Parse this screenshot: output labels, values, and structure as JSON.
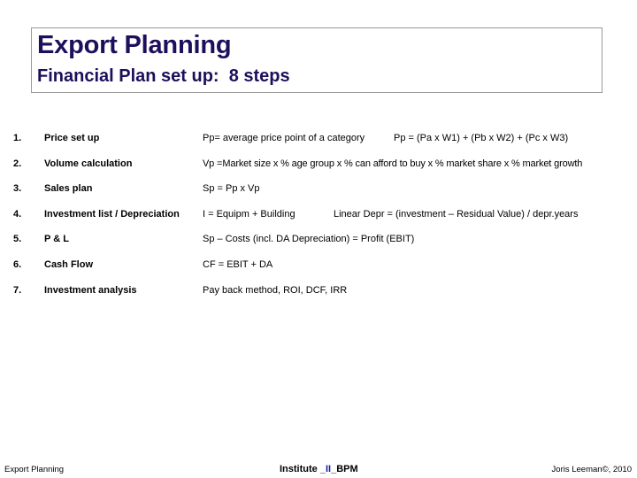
{
  "header": {
    "title": "Export Planning",
    "subtitle": "Financial Plan set up:  8 steps"
  },
  "steps": [
    {
      "number": "1.",
      "label": "Price set up",
      "formula": "Pp= average price point of a category",
      "formula2": "Pp = (Pa x W1) + (Pb x W2) + (Pc x W3)"
    },
    {
      "number": "2.",
      "label": "Volume calculation",
      "formula": "Vp =Market size x % age group x % can afford to buy x % market share x % market growth"
    },
    {
      "number": "3.",
      "label": "Sales plan",
      "formula": "Sp = Pp x Vp"
    },
    {
      "number": "4.",
      "label": "Investment list / Depreciation",
      "formula": "I = Equipm + Building",
      "formula2": "Linear Depr = (investment – Residual Value) / depr.years"
    },
    {
      "number": "5.",
      "label": "P & L",
      "formula": "Sp – Costs (incl. DA Depreciation) = Profit (EBIT)"
    },
    {
      "number": "6.",
      "label": "Cash Flow",
      "formula": "CF = EBIT + DA"
    },
    {
      "number": "7.",
      "label": "Investment analysis",
      "formula": "Pay back method, ROI, DCF, IRR"
    }
  ],
  "footer": {
    "left": "Export Planning",
    "center_prefix": "Institute _",
    "center_accent": "II",
    "center_suffix": "_BPM",
    "right": "Joris Leeman©, 2010"
  },
  "colors": {
    "title": "#1e0f5c",
    "footer_accent": "#1a1aa6",
    "title_box_border": "#9a9a9a"
  }
}
